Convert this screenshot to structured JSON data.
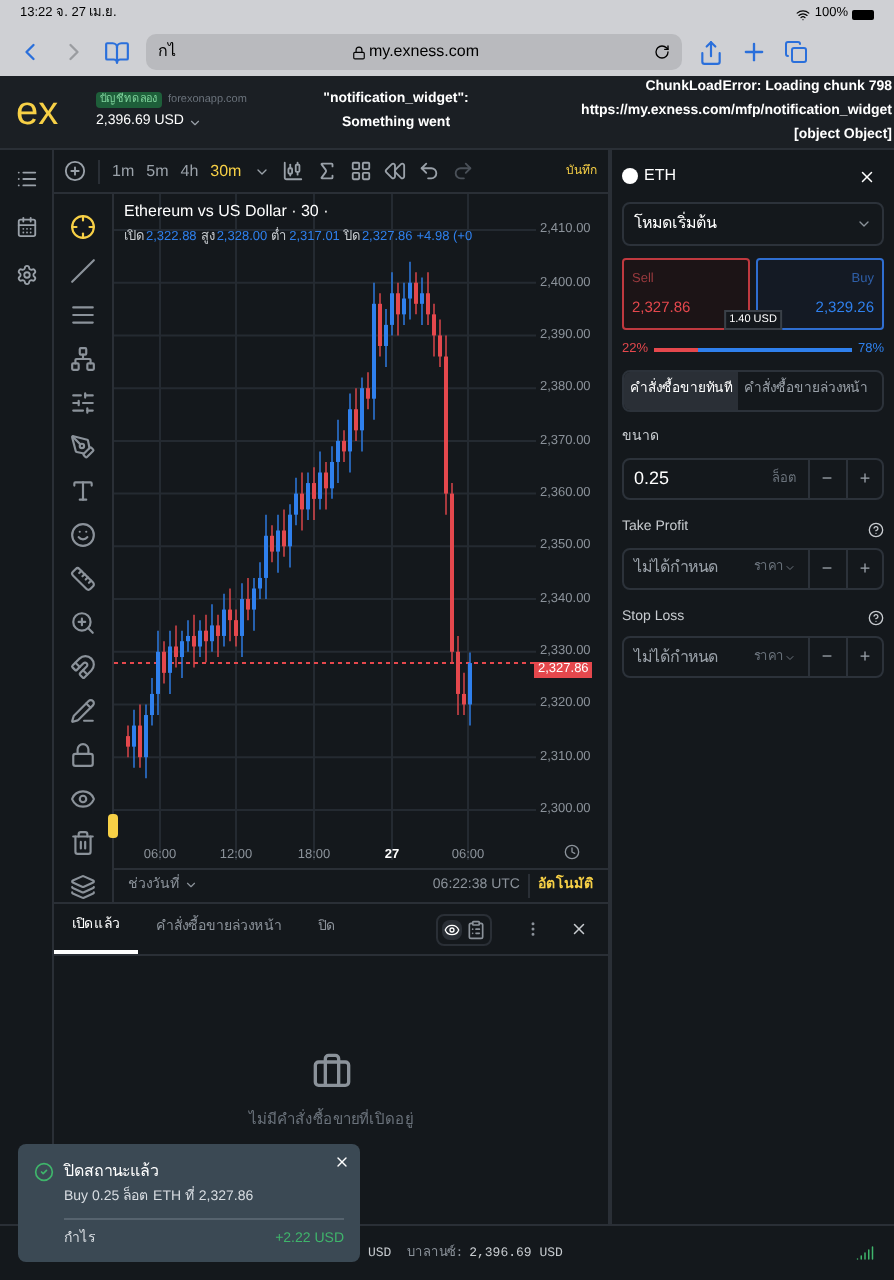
{
  "status_bar": {
    "time": "13:22",
    "date": "จ. 27 เม.ย.",
    "battery": "100%"
  },
  "browser": {
    "address_text": "กไ",
    "url": "my.exness.com"
  },
  "header": {
    "logo": "ex",
    "account_badge": "บัญชีทดลอง",
    "server": "forexonapp.com",
    "balance": "2,396.69 USD",
    "error_1": [
      "\"notification_widget\":",
      "Something went"
    ],
    "error_2": [
      "ChunkLoadError: Loading chunk 798",
      "https://my.exness.com/mfp/notification_widget",
      "[object Object]"
    ]
  },
  "toolbar": {
    "timeframes": [
      {
        "label": "1m",
        "selected": false
      },
      {
        "label": "5m",
        "selected": false
      },
      {
        "label": "4h",
        "selected": false
      },
      {
        "label": "30m",
        "selected": true
      }
    ],
    "save_label": "บันทึก"
  },
  "drawing_tools": [
    {
      "kind": "crosshair",
      "selected": true
    },
    {
      "kind": "line",
      "selected": false
    },
    {
      "kind": "channel",
      "selected": false
    },
    {
      "kind": "pattern",
      "selected": false
    },
    {
      "kind": "sliders",
      "selected": false
    },
    {
      "kind": "pen",
      "selected": false
    },
    {
      "kind": "text",
      "selected": false
    },
    {
      "kind": "smile",
      "selected": false
    },
    {
      "kind": "ruler",
      "selected": false
    },
    {
      "kind": "zoom",
      "selected": false
    },
    {
      "kind": "magnet",
      "selected": false
    },
    {
      "kind": "pencil",
      "selected": false
    },
    {
      "kind": "lock",
      "selected": false
    },
    {
      "kind": "eye",
      "selected": false
    },
    {
      "kind": "trash",
      "selected": false
    },
    {
      "kind": "layers",
      "selected": false
    }
  ],
  "chart": {
    "title": "Ethereum vs US Dollar · 30 ·",
    "ohlc": [
      {
        "label": "เปิด",
        "value": "2,322.88"
      },
      {
        "label": "สูง",
        "value": "2,328.00"
      },
      {
        "label": "ต่ำ",
        "value": "2,317.01"
      },
      {
        "label": "ปิด",
        "value": "2,327.86"
      }
    ],
    "change": "+4.98 (+0",
    "price_labels": [
      "2,410.00",
      "2,400.00",
      "2,390.00",
      "2,380.00",
      "2,370.00",
      "2,360.00",
      "2,350.00",
      "2,340.00",
      "2,330.00",
      "2,320.00",
      "2,310.00",
      "2,300.00"
    ],
    "current_price": "2,327.86",
    "time_labels": [
      {
        "label": "06:00",
        "bold": false
      },
      {
        "label": "12:00",
        "bold": false
      },
      {
        "label": "18:00",
        "bold": false
      },
      {
        "label": "27",
        "bold": true
      },
      {
        "label": "06:00",
        "bold": false
      }
    ],
    "range_label": "ช่วงวันที่",
    "clock": "06:22:38 UTC",
    "auto": {
      "label": "อัตโนมัติ",
      "on": true
    }
  },
  "positions": {
    "tabs": [
      {
        "label": "เปิดแล้ว",
        "selected": true
      },
      {
        "label": "คำสั่งซื้อขายล่วงหน้า",
        "selected": false
      },
      {
        "label": "ปิด",
        "selected": false
      }
    ],
    "empty_text": "ไม่มีคำสั่งซื้อขายที่เปิดอยู่"
  },
  "footer": {
    "currency": "USD",
    "balance_label": "บาลานซ์:",
    "balance": "2,396.69 USD"
  },
  "toast": {
    "title": "ปิดสถานะแล้ว",
    "detail": "Buy 0.25 ล็อต ETH ที่ 2,327.86",
    "profit_label": "กำไร",
    "profit": "+2.22 USD"
  },
  "order_panel": {
    "symbol": "ETH",
    "mode": "โหมดเริ่มต้น",
    "sell": {
      "label": "Sell",
      "price": "2,327.86"
    },
    "buy": {
      "label": "Buy",
      "price": "2,329.26"
    },
    "spread": "1.40 USD",
    "sentiment": {
      "sell_pct": "22%",
      "buy_pct": "78%",
      "level": 0.22
    },
    "order_types": [
      {
        "label": "คำสั่งซื้อขายทันที",
        "selected": true
      },
      {
        "label": "คำสั่งซื้อขายล่วงหน้า",
        "selected": false
      }
    ],
    "volume": {
      "label": "ขนาด",
      "value": "0.25",
      "unit": "ล็อต",
      "minus": "−",
      "plus": "+"
    },
    "take_profit": {
      "label": "Take Profit",
      "placeholder": "ไม่ได้กำหนด",
      "unit": "ราคา",
      "minus": "−",
      "plus": "+"
    },
    "stop_loss": {
      "label": "Stop Loss",
      "placeholder": "ไม่ได้กำหนด",
      "unit": "ราคา",
      "minus": "−",
      "plus": "+"
    }
  }
}
